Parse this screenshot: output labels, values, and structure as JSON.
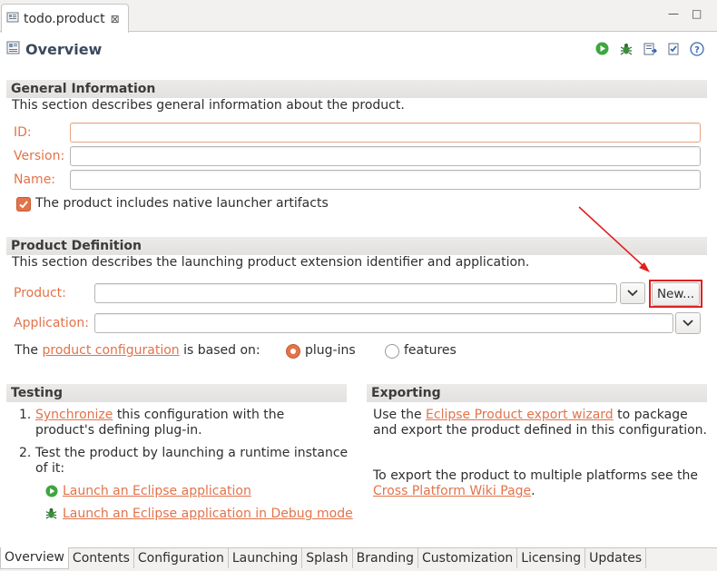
{
  "editor_tab": {
    "title": "todo.product",
    "close_glyph": "⊠"
  },
  "window_controls": {
    "minimize": "—",
    "maximize": "□"
  },
  "overview": {
    "title": "Overview"
  },
  "general_info": {
    "heading": "General Information",
    "description": "This section describes general information about the product.",
    "id_label": "ID:",
    "id_value": "",
    "version_label": "Version:",
    "version_value": "",
    "name_label": "Name:",
    "name_value": "",
    "launcher_checkbox_label": "The product includes native launcher artifacts",
    "launcher_checked": true
  },
  "product_definition": {
    "heading": "Product Definition",
    "description": "This section describes the launching product extension identifier and application.",
    "product_label": "Product:",
    "product_value": "",
    "new_button_label": "New...",
    "application_label": "Application:",
    "application_value": "",
    "config_prefix": "The",
    "config_link": "product configuration",
    "config_suffix": "is based on:",
    "option_plugins": "plug-ins",
    "option_features": "features",
    "selected_option": "plug-ins"
  },
  "testing": {
    "heading": "Testing",
    "step1_num": "1.",
    "step1_link": "Synchronize",
    "step1_text": "this configuration with the",
    "step1_text2": "product's defining plug-in.",
    "step2_num": "2.",
    "step2_text": "Test the product by launching a runtime instance",
    "step2_text2": "of it:",
    "launch_link": "Launch an Eclipse application",
    "debug_link": "Launch an Eclipse application in Debug mode"
  },
  "exporting": {
    "heading": "Exporting",
    "line1_prefix": "Use the",
    "line1_link": "Eclipse Product export wizard",
    "line1_suffix": "to package",
    "line2": "and export the product defined in this configuration.",
    "line3": "To export the product to multiple platforms see the",
    "wiki_link": "Cross Platform Wiki Page",
    "wiki_suffix": "."
  },
  "bottom_tabs": [
    "Overview",
    "Contents",
    "Configuration",
    "Launching",
    "Splash",
    "Branding",
    "Customization",
    "Licensing",
    "Updates"
  ],
  "icons": {
    "tab_icon": "product-file-icon",
    "overview_icon": "overview-form-icon",
    "toolbar": [
      "run-icon",
      "debug-icon",
      "export-icon",
      "validate-icon",
      "help-icon"
    ]
  },
  "colors": {
    "accent": "#e2734a",
    "annotation": "#e02020"
  }
}
